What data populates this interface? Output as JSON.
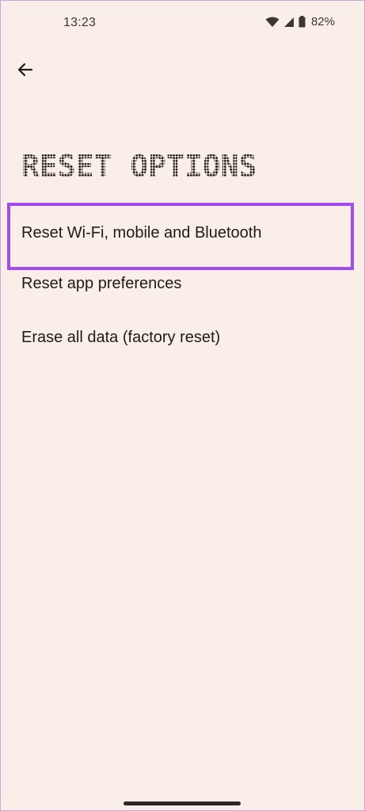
{
  "status_bar": {
    "time": "13:23",
    "battery_percent": "82%",
    "icons": [
      "wifi-icon",
      "signal-icon",
      "battery-icon"
    ]
  },
  "header": {
    "back_icon": "back-arrow-icon"
  },
  "page": {
    "title": "RESET OPTIONS"
  },
  "options": [
    {
      "label": "Reset Wi-Fi, mobile and Bluetooth",
      "highlighted": true
    },
    {
      "label": "Reset app preferences",
      "highlighted": false
    },
    {
      "label": "Erase all data (factory reset)",
      "highlighted": false
    }
  ],
  "colors": {
    "background": "#f9eee8",
    "text": "#1f1b18",
    "highlight": "#a24cf0"
  }
}
